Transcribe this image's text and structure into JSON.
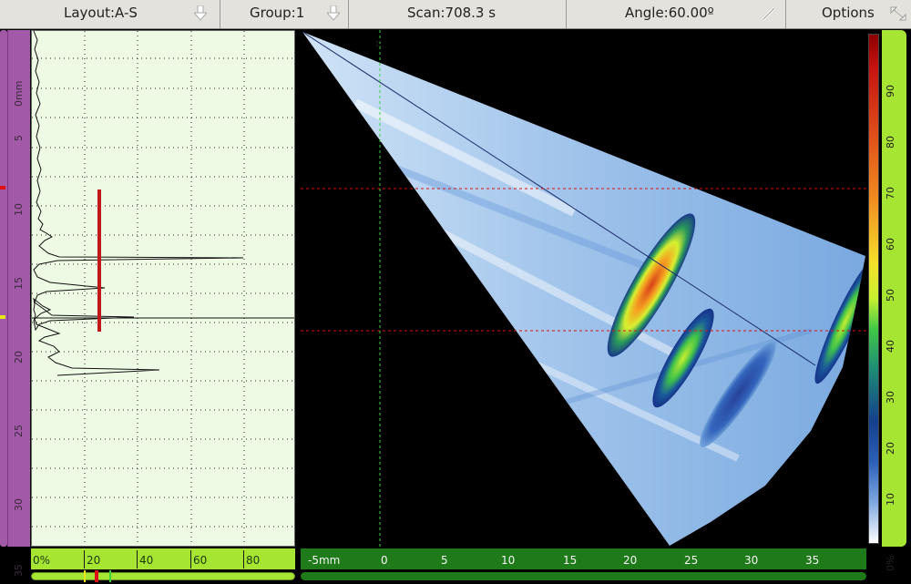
{
  "toolbar": {
    "layout": "Layout:A-S",
    "group": "Group:1",
    "scan": "Scan:708.3 s",
    "angle": "Angle:60.00º",
    "options": "Options"
  },
  "depth_axis": {
    "ticks": [
      "0mm",
      "5",
      "10",
      "15",
      "20",
      "25",
      "30",
      "35"
    ]
  },
  "amplitude_axis": {
    "ticks": [
      "0%",
      "20",
      "40",
      "60",
      "80"
    ]
  },
  "index_axis": {
    "ticks": [
      "-5mm",
      "0",
      "5",
      "10",
      "15",
      "20",
      "25",
      "30",
      "35"
    ]
  },
  "color_scale": {
    "ticks": [
      "90",
      "80",
      "70",
      "60",
      "50",
      "40",
      "30",
      "20",
      "10",
      "0%"
    ]
  },
  "colors": {
    "panel_bg": "#eefbe4",
    "ruler_green": "#a7e533",
    "ruler_purple": "#a25aa8",
    "index_bar": "#1f7a1a",
    "gate_red": "#c01818",
    "cursor_green": "#3ad23a"
  }
}
